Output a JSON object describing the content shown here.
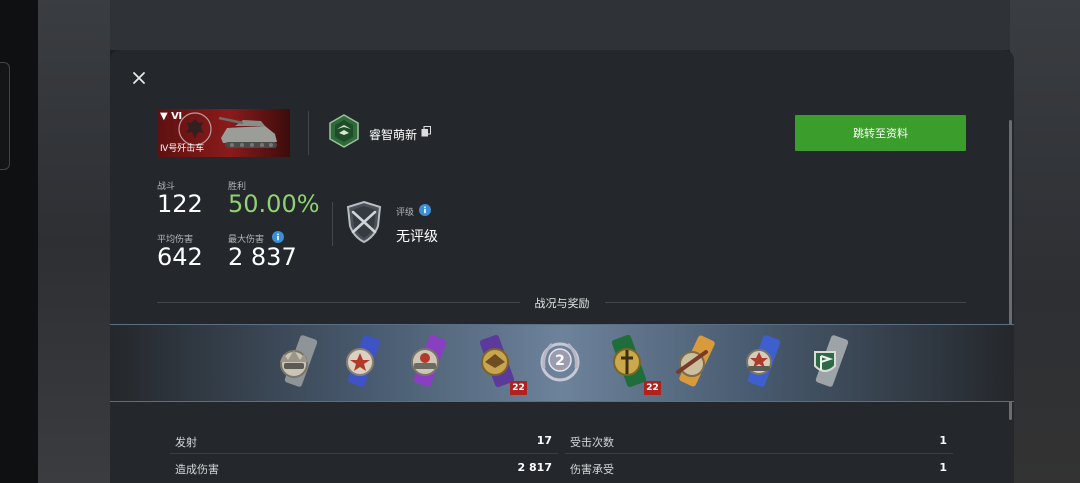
{
  "vehicle": {
    "tier": "▼ Ⅵ",
    "name": "Ⅳ号歼击车"
  },
  "player": {
    "name": "睿智萌新"
  },
  "profile_button": "跳转至资料",
  "stats": {
    "battles_label": "战斗",
    "battles_value": "122",
    "win_label": "胜利",
    "win_value": "50.00%",
    "avg_damage_label": "平均伤害",
    "avg_damage_value": "642",
    "max_damage_label": "最大伤害",
    "max_damage_value": "2 837"
  },
  "rating": {
    "label": "评级",
    "value": "无评级"
  },
  "section_title": "战况与奖励",
  "awards": [
    {
      "icon": "medal-tank-gray-icon",
      "count": ""
    },
    {
      "icon": "medal-star-blue-icon",
      "count": ""
    },
    {
      "icon": "medal-tank-purple-icon",
      "count": ""
    },
    {
      "icon": "medal-eagle-purple-icon",
      "count": "22"
    },
    {
      "icon": "medal-mastery-2-icon",
      "count": ""
    },
    {
      "icon": "medal-sword-green-icon",
      "count": "22"
    },
    {
      "icon": "medal-cannon-orange-icon",
      "count": ""
    },
    {
      "icon": "medal-tank-blue-icon",
      "count": ""
    },
    {
      "icon": "medal-flag-gray-icon",
      "count": ""
    }
  ],
  "table": {
    "left": [
      {
        "label": "发射",
        "value": "17"
      },
      {
        "label": "造成伤害",
        "value": "2 817"
      }
    ],
    "right": [
      {
        "label": "受击次数",
        "value": "1"
      },
      {
        "label": "伤害承受",
        "value": "1"
      }
    ]
  },
  "colors": {
    "accent_green": "#3b9d2c",
    "win_green": "#8fd26f",
    "count_badge": "#b0221c",
    "vehicle_red": "#8a1b1b"
  }
}
